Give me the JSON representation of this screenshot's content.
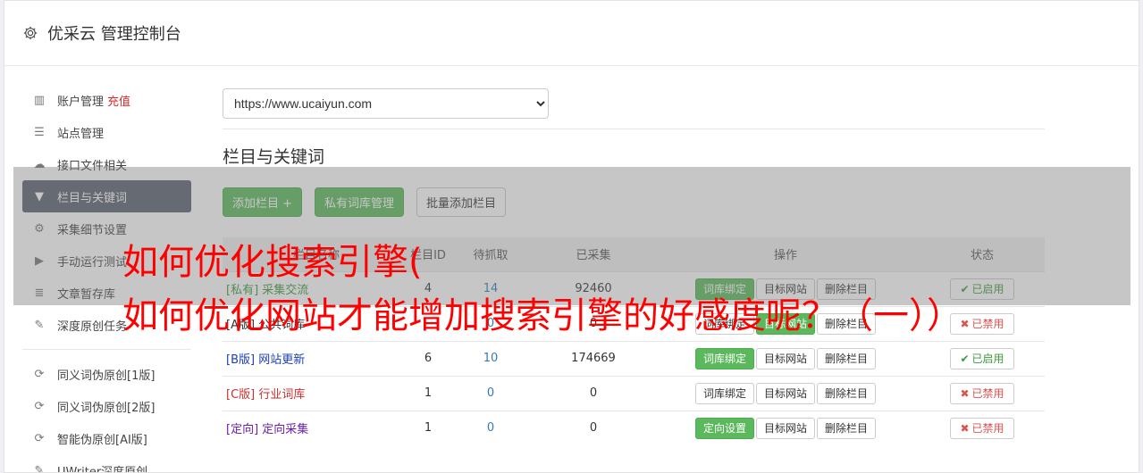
{
  "app": {
    "title": "优采云 管理控制台"
  },
  "sidebar": {
    "items": [
      {
        "label": "账户管理",
        "extra": "充值"
      },
      {
        "label": "站点管理"
      },
      {
        "label": "接口文件相关"
      },
      {
        "label": "栏目与关键词"
      },
      {
        "label": "采集细节设置"
      },
      {
        "label": "手动运行测试"
      },
      {
        "label": "文章暂存库"
      },
      {
        "label": "深度原创任务"
      },
      {
        "label": "同义词伪原创[1版]"
      },
      {
        "label": "同义词伪原创[2版]"
      },
      {
        "label": "智能伪原创[AI版]"
      },
      {
        "label": "UWriter深度原创"
      }
    ]
  },
  "main": {
    "site_select": "https://www.ucaiyun.com",
    "section_title": "栏目与关键词",
    "buttons": {
      "add": "添加栏目 +",
      "private_lib": "私有词库管理",
      "batch_add": "批量添加栏目"
    },
    "table": {
      "headers": {
        "name": "栏目名称",
        "id": "栏目ID",
        "pending": "待抓取",
        "collected": "已采集",
        "ops": "操作",
        "status": "状态"
      },
      "rows": [
        {
          "tag": "[私有]",
          "name": "采集交流",
          "id": "4",
          "pending": "14",
          "collected": "92460",
          "op1": "词库绑定",
          "op2": "目标网站",
          "op3": "删除栏目",
          "status": "已启用"
        },
        {
          "tag": "[A版]",
          "name": "公共词库",
          "id": "",
          "pending": "0",
          "collected": "0",
          "op1": "词库绑定",
          "op2": "目标网站",
          "op3": "删除栏目",
          "status": "已禁用"
        },
        {
          "tag": "[B版]",
          "name": "网站更新",
          "id": "6",
          "pending": "10",
          "collected": "174669",
          "op1": "词库绑定",
          "op2": "目标网站",
          "op3": "删除栏目",
          "status": "已启用"
        },
        {
          "tag": "[C版]",
          "name": "行业词库",
          "id": "1",
          "pending": "0",
          "collected": "0",
          "op1": "词库绑定",
          "op2": "目标网站",
          "op3": "删除栏目",
          "status": "已禁用"
        },
        {
          "tag": "[定向]",
          "name": "定向采集",
          "id": "1",
          "pending": "0",
          "collected": "0",
          "op1": "定向设置",
          "op2": "目标网站",
          "op3": "删除栏目",
          "status": "已禁用"
        }
      ]
    }
  },
  "overlay": {
    "line1": "如何优化搜索引擎(",
    "line2": "如何优化网站才能增加搜索引擎的好感度呢？（一））"
  },
  "colors": {
    "green": "#5cb85c",
    "active_nav": "#5b6371",
    "red": "#ff0000"
  }
}
